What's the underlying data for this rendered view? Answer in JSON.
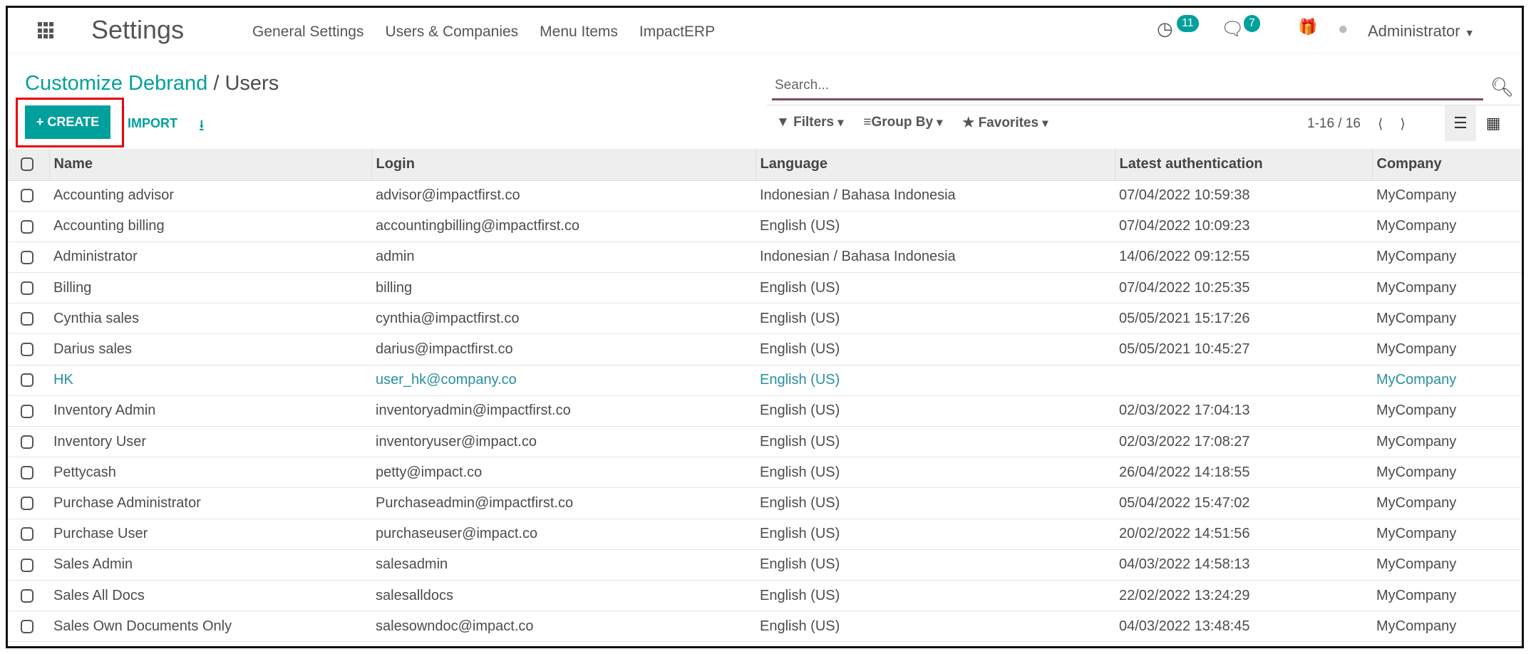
{
  "nav": {
    "app": "Settings",
    "menu": [
      "General Settings",
      "Users & Companies",
      "Menu Items",
      "ImpactERP"
    ],
    "activity_count": "11",
    "message_count": "7",
    "user": "Administrator"
  },
  "breadcrumb": {
    "parent": "Customize Debrand",
    "sep": "/",
    "current": "Users"
  },
  "search": {
    "placeholder": "Search..."
  },
  "toolbar": {
    "create": "+ CREATE",
    "import": "IMPORT",
    "filters": "Filters",
    "group_by": "Group By",
    "favorites": "Favorites",
    "pager": "1-16 / 16"
  },
  "colors": {
    "accent": "#00a09d",
    "highlight": "#e8000b"
  },
  "table": {
    "headers": [
      "Name",
      "Login",
      "Language",
      "Latest authentication",
      "Company"
    ],
    "rows": [
      [
        "Accounting advisor",
        "advisor@impactfirst.co",
        "Indonesian / Bahasa Indonesia",
        "07/04/2022 10:59:38",
        "MyCompany"
      ],
      [
        "Accounting billing",
        "accountingbilling@impactfirst.co",
        "English (US)",
        "07/04/2022 10:09:23",
        "MyCompany"
      ],
      [
        "Administrator",
        "admin",
        "Indonesian / Bahasa Indonesia",
        "14/06/2022 09:12:55",
        "MyCompany"
      ],
      [
        "Billing",
        "billing",
        "English (US)",
        "07/04/2022 10:25:35",
        "MyCompany"
      ],
      [
        "Cynthia sales",
        "cynthia@impactfirst.co",
        "English (US)",
        "05/05/2021 15:17:26",
        "MyCompany"
      ],
      [
        "Darius sales",
        "darius@impactfirst.co",
        "English (US)",
        "05/05/2021 10:45:27",
        "MyCompany"
      ],
      [
        "HK",
        "user_hk@company.co",
        "English (US)",
        "",
        "MyCompany"
      ],
      [
        "Inventory Admin",
        "inventoryadmin@impactfirst.co",
        "English (US)",
        "02/03/2022 17:04:13",
        "MyCompany"
      ],
      [
        "Inventory User",
        "inventoryuser@impact.co",
        "English (US)",
        "02/03/2022 17:08:27",
        "MyCompany"
      ],
      [
        "Pettycash",
        "petty@impact.co",
        "English (US)",
        "26/04/2022 14:18:55",
        "MyCompany"
      ],
      [
        "Purchase Administrator",
        "Purchaseadmin@impactfirst.co",
        "English (US)",
        "05/04/2022 15:47:02",
        "MyCompany"
      ],
      [
        "Purchase User",
        "purchaseuser@impact.co",
        "English (US)",
        "20/02/2022 14:51:56",
        "MyCompany"
      ],
      [
        "Sales Admin",
        "salesadmin",
        "English (US)",
        "04/03/2022 14:58:13",
        "MyCompany"
      ],
      [
        "Sales All Docs",
        "salesalldocs",
        "English (US)",
        "22/02/2022 13:24:29",
        "MyCompany"
      ],
      [
        "Sales Own Documents Only",
        "salesowndoc@impact.co",
        "English (US)",
        "04/03/2022 13:48:45",
        "MyCompany"
      ]
    ]
  }
}
